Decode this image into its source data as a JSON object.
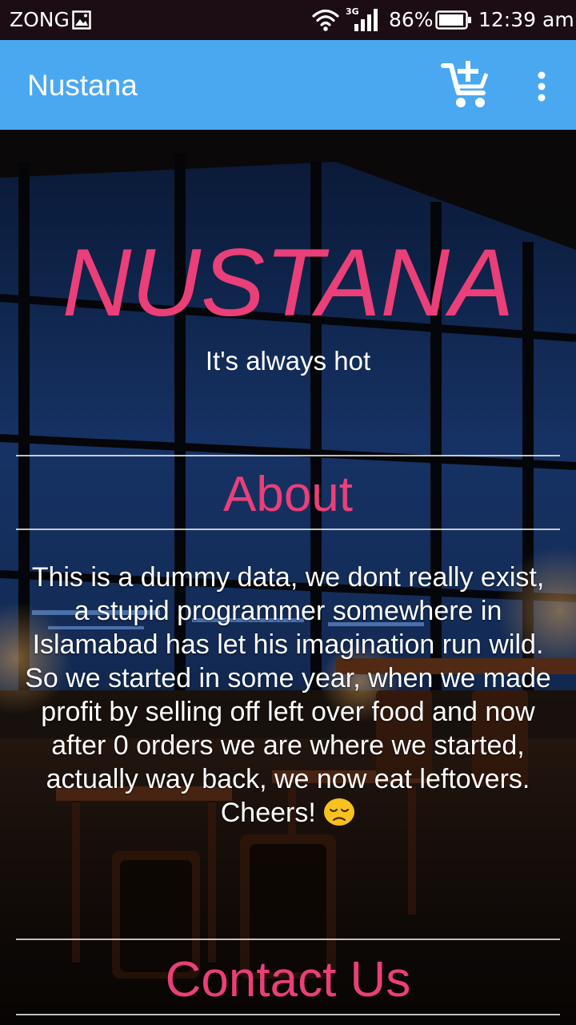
{
  "status_bar": {
    "carrier": "ZONG",
    "network_type": "3G",
    "battery_percent": "86%",
    "time": "12:39 am",
    "icons": [
      "gallery-icon",
      "wifi-icon",
      "signal-icon",
      "battery-icon"
    ]
  },
  "app_bar": {
    "title": "Nustana",
    "actions": [
      "add-to-cart-icon",
      "overflow-menu-icon"
    ],
    "color": "#4aa8f0"
  },
  "hero": {
    "brand_name": "NUSTANA",
    "tagline": "It's always hot",
    "brand_color": "#ea3f78"
  },
  "about": {
    "heading": "About",
    "paragraph_1": "This is a dummy data, we dont really exist, a stupid programmer somewhere in Islamabad has let his imagination run wild.",
    "paragraph_2": "So we started in some year, when we made profit by selling off left over food and now after 0 orders we are where we started, actually way back, we now eat leftovers. Cheers!",
    "emoji": "sad-face-emoji"
  },
  "contact": {
    "heading": "Contact Us"
  }
}
